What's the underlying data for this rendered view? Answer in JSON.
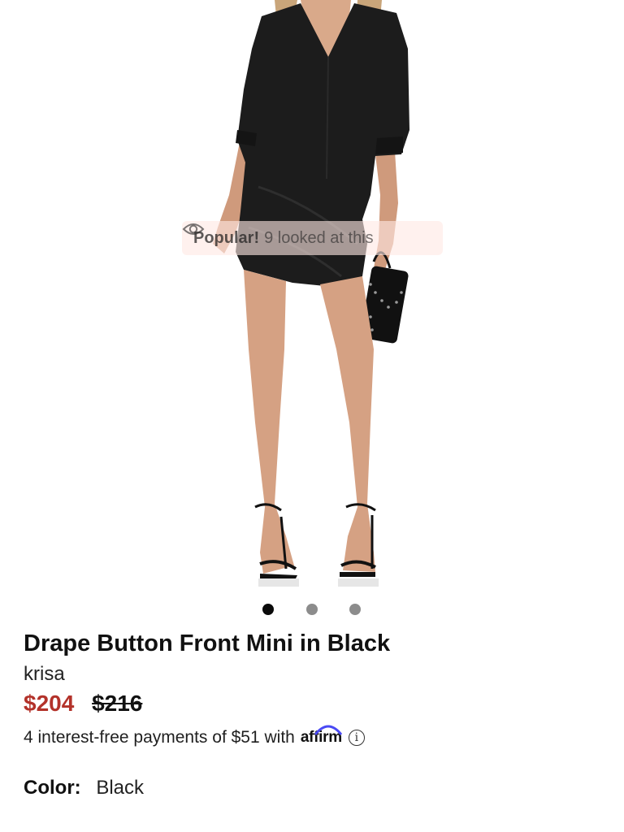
{
  "gallery": {
    "image_alt": "Model wearing drape button front mini dress in black",
    "popular_badge": {
      "icon": "eye-icon",
      "strong_text": "Popular!",
      "text": "9 looked at this"
    },
    "dots": {
      "count": 3,
      "active_index": 0
    }
  },
  "product": {
    "title": "Drape Button Front Mini in Black",
    "brand": "krisa",
    "price_sale": "$204",
    "price_original": "$216",
    "installments_text": "4 interest-free payments of $51 with",
    "affirm_logo": "affirm",
    "info_icon": "info-icon",
    "color_label": "Color",
    "color_separator": ":",
    "color_value": "Black"
  },
  "colors": {
    "sale_price": "#b3322a",
    "text": "#111111",
    "dot_active": "#0a0a0a",
    "dot_inactive": "#8c8c8c",
    "affirm_blue": "#4a4af4"
  }
}
